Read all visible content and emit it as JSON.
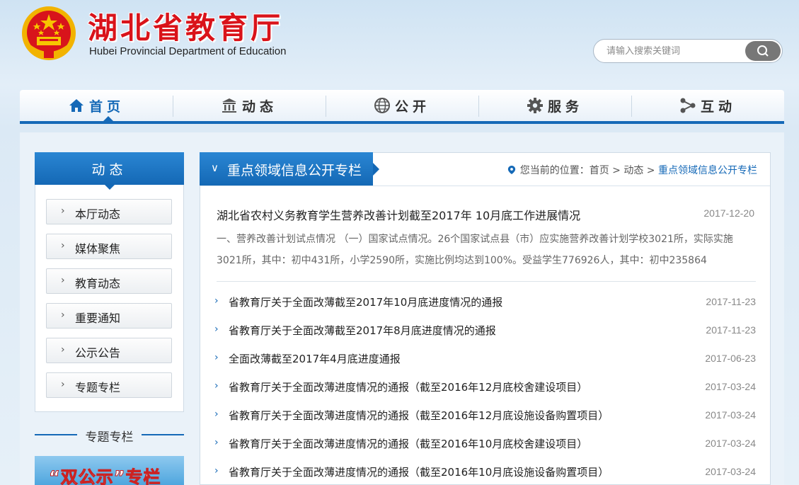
{
  "header": {
    "title": "湖北省教育厅",
    "subtitle": "Hubei Provincial Department of Education",
    "search_placeholder": "请输入搜索关键词"
  },
  "nav": [
    {
      "label": "首页",
      "icon": "home-icon",
      "active": true
    },
    {
      "label": "动态",
      "icon": "building-icon",
      "active": false
    },
    {
      "label": "公开",
      "icon": "globe-icon",
      "active": false
    },
    {
      "label": "服务",
      "icon": "gear-icon",
      "active": false
    },
    {
      "label": "互动",
      "icon": "share-icon",
      "active": false
    }
  ],
  "sidebar": {
    "title": "动态",
    "items": [
      {
        "label": "本厅动态"
      },
      {
        "label": "媒体聚焦"
      },
      {
        "label": "教育动态"
      },
      {
        "label": "重要通知"
      },
      {
        "label": "公示公告"
      },
      {
        "label": "专题专栏"
      }
    ],
    "special_title": "专题专栏",
    "banner_text": "“双公示”专栏"
  },
  "main": {
    "tab_label": "重点领域信息公开专栏",
    "breadcrumb": {
      "prefix": "您当前的位置：",
      "home": "首页",
      "sep1": " > ",
      "section": "动态",
      "sep2": " > ",
      "current": "重点领域信息公开专栏"
    },
    "featured": {
      "title": "湖北省农村义务教育学生营养改善计划截至2017年 10月底工作进展情况",
      "date": "2017-12-20",
      "summary": "一、营养改善计划试点情况 （一）国家试点情况。26个国家试点县（市）应实施营养改善计划学校3021所，实际实施3021所，其中：初中431所，小学2590所，实施比例均达到100%。受益学生776926人，其中：初中235864"
    },
    "items": [
      {
        "title": "省教育厅关于全面改薄截至2017年10月底进度情况的通报",
        "date": "2017-11-23"
      },
      {
        "title": "省教育厅关于全面改薄截至2017年8月底进度情况的通报",
        "date": "2017-11-23"
      },
      {
        "title": "全面改薄截至2017年4月底进度通报",
        "date": "2017-06-23"
      },
      {
        "title": "省教育厅关于全面改薄进度情况的通报（截至2016年12月底校舍建设项目）",
        "date": "2017-03-24"
      },
      {
        "title": "省教育厅关于全面改薄进度情况的通报（截至2016年12月底设施设备购置项目）",
        "date": "2017-03-24"
      },
      {
        "title": "省教育厅关于全面改薄进度情况的通报（截至2016年10月底校舍建设项目）",
        "date": "2017-03-24"
      },
      {
        "title": "省教育厅关于全面改薄进度情况的通报（截至2016年10月底设施设备购置项目）",
        "date": "2017-03-24"
      }
    ]
  },
  "colors": {
    "brand_blue": "#1569b7",
    "title_red": "#d9131a"
  }
}
